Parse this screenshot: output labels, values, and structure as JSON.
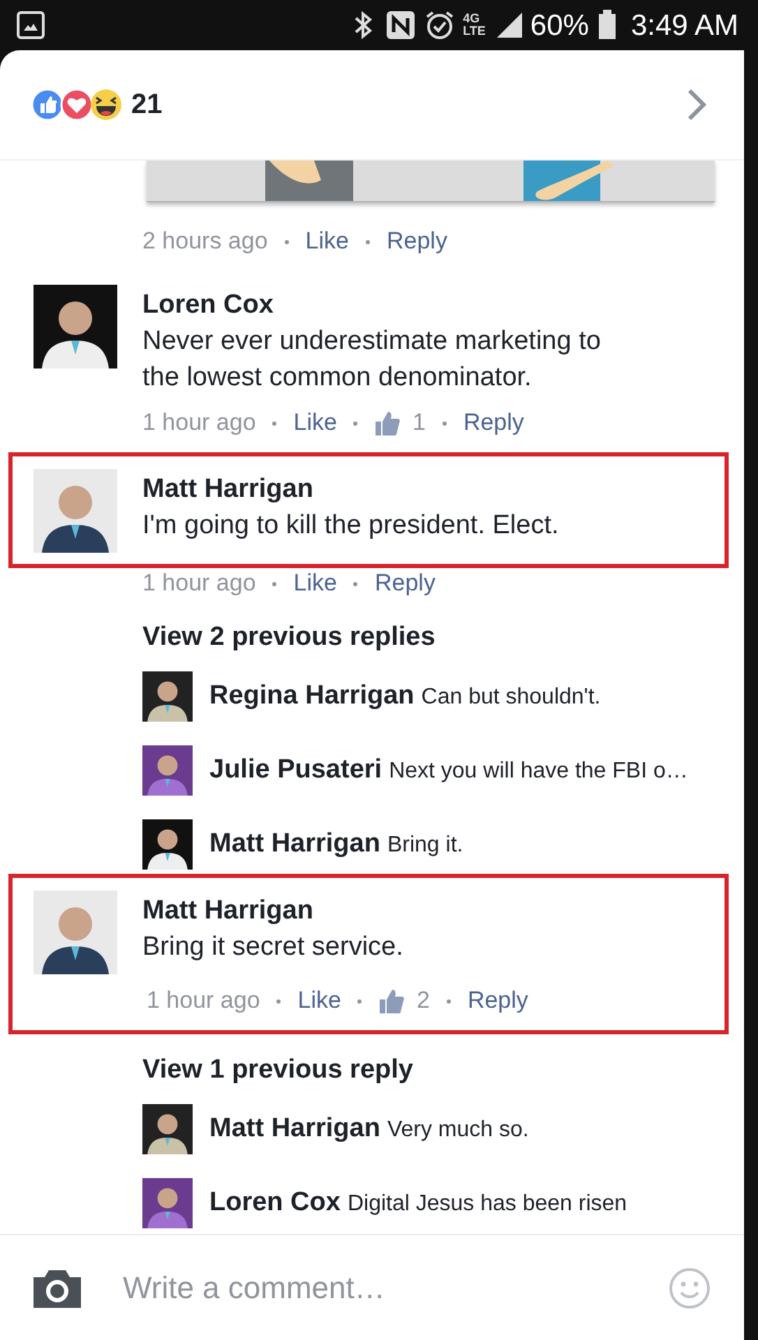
{
  "status_bar": {
    "network": "4G",
    "network_sub": "LTE",
    "battery": "60%",
    "time": "3:49 AM"
  },
  "header": {
    "reaction_count": "21"
  },
  "feed": [
    {
      "kind": "post_end",
      "meta": {
        "time": "2 hours ago",
        "like": "Like",
        "reply": "Reply"
      }
    },
    {
      "kind": "comment",
      "name": "Loren Cox",
      "text": "Never ever underestimate marketing to the lowest common denominator.",
      "highlighted": false,
      "meta": {
        "time": "1 hour ago",
        "like": "Like",
        "like_count": "1",
        "reply": "Reply"
      }
    },
    {
      "kind": "comment",
      "name": "Matt Harrigan",
      "text": "I'm going to kill the president. Elect.",
      "highlighted": true,
      "meta_highlighted": false,
      "meta": {
        "time": "1 hour ago",
        "like": "Like",
        "reply": "Reply"
      }
    },
    {
      "kind": "more",
      "label": "View 2 previous replies"
    },
    {
      "kind": "reply",
      "name": "Regina Harrigan",
      "text": "Can but shouldn't."
    },
    {
      "kind": "reply",
      "name": "Julie Pusateri",
      "text": "Next you will have the FBI o…"
    },
    {
      "kind": "reply",
      "name": "Matt Harrigan",
      "text": "Bring it."
    },
    {
      "kind": "comment",
      "name": "Matt Harrigan",
      "text": "Bring it secret service.",
      "highlighted": true,
      "meta_highlighted": true,
      "meta": {
        "time": "1 hour ago",
        "like": "Like",
        "like_count": "2",
        "reply": "Reply"
      }
    },
    {
      "kind": "more",
      "label": "View 1 previous reply"
    },
    {
      "kind": "reply",
      "name": "Matt Harrigan",
      "text": "Very much so."
    },
    {
      "kind": "reply",
      "name": "Loren Cox",
      "text": "Digital Jesus has been risen"
    }
  ],
  "composer": {
    "placeholder": "Write a comment…"
  }
}
